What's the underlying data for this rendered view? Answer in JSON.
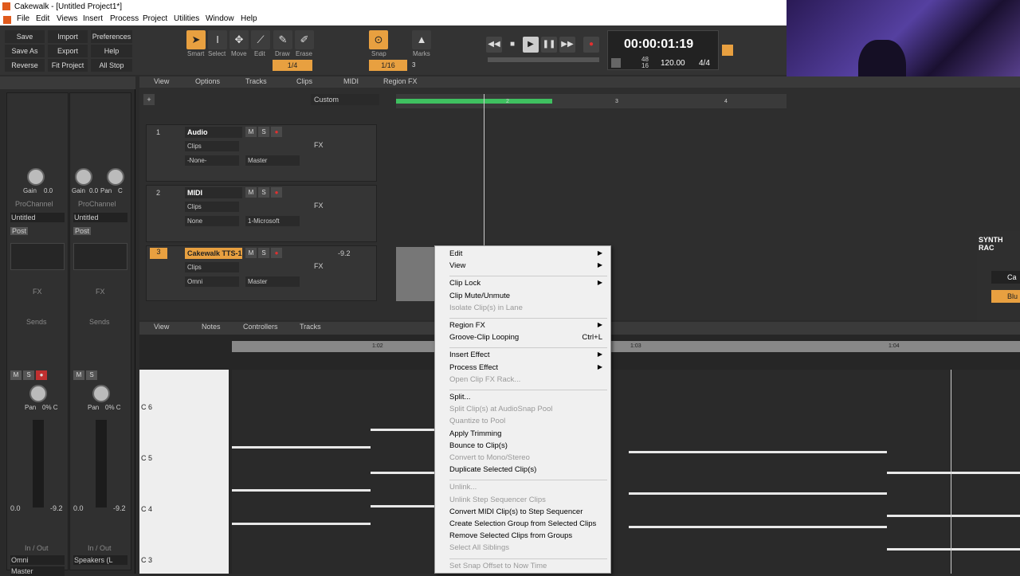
{
  "window": {
    "title": "Cakewalk - [Untitled Project1*]"
  },
  "menubar": [
    "File",
    "Edit",
    "Views",
    "Insert",
    "Process",
    "Project",
    "Utilities",
    "Window",
    "Help"
  ],
  "control_bar": {
    "buttons": [
      "Save",
      "Import",
      "Preferences",
      "Save As",
      "Export",
      "Help",
      "Reverse",
      "Fit Project",
      "All Stop"
    ],
    "tools": [
      "Smart",
      "Select",
      "Move",
      "Edit",
      "Draw",
      "Erase"
    ],
    "tool_value": "1/4",
    "snap_label": "Snap",
    "snap_value": "1/16",
    "snap_extra": "3",
    "marks_label": "Marks"
  },
  "transport": {
    "time": "00:00:01:19",
    "sig_top": "48",
    "sig_bottom": "16",
    "tempo": "120.00",
    "meter": "4/4"
  },
  "inspector": {
    "strips": [
      {
        "gain": "Gain",
        "gain_val": "0.0",
        "prochannel": "ProChannel",
        "name": "Untitled",
        "post": "Post",
        "fx": "FX",
        "sends": "Sends",
        "pan": "Pan",
        "pan_val": "0% C",
        "vol": "0.0",
        "peak": "-9.2",
        "inout": "In / Out",
        "in": "Omni",
        "out": "Master"
      },
      {
        "gain": "Gain",
        "gain_val": "0.0",
        "pan_small": "Pan",
        "pan_small_val": "C",
        "prochannel": "ProChannel",
        "name": "Untitled",
        "post": "Post",
        "fx": "FX",
        "sends": "Sends",
        "pan": "Pan",
        "pan_val": "0% C",
        "vol": "0.0",
        "peak": "-9.2",
        "inout": "In / Out",
        "in": "Speakers (L"
      }
    ]
  },
  "trackview": {
    "menu": [
      "View",
      "Options",
      "Tracks",
      "Clips",
      "MIDI",
      "Region FX"
    ],
    "preset": "Custom",
    "ruler": [
      "2",
      "3",
      "4"
    ],
    "tracks": [
      {
        "num": "1",
        "name": "Audio",
        "clips": "Clips",
        "input": "-None-",
        "output": "Master",
        "fx": "FX"
      },
      {
        "num": "2",
        "name": "MIDI",
        "clips": "Clips",
        "input": "None",
        "output": "1-Microsoft",
        "fx": "FX"
      },
      {
        "num": "3",
        "name": "Cakewalk TTS-1",
        "clips": "Clips",
        "input": "Omni",
        "output": "Master",
        "fx": "FX",
        "level": "-9.2"
      }
    ]
  },
  "synth_rack": {
    "title": "SYNTH RAC",
    "item1": "Ca",
    "item2": "Blu"
  },
  "pianoroll": {
    "menu": [
      "View",
      "Notes",
      "Controllers",
      "Tracks"
    ],
    "ruler": [
      "1:02",
      "1:03",
      "1:04"
    ],
    "keys": [
      "C 6",
      "C 5",
      "C 4",
      "C 3"
    ]
  },
  "context_menu": {
    "items": [
      {
        "label": "Edit",
        "sub": true,
        "dis": false
      },
      {
        "label": "View",
        "sub": true,
        "dis": false
      },
      {
        "sep": true
      },
      {
        "label": "Clip Lock",
        "sub": true,
        "dis": false
      },
      {
        "label": "Clip Mute/Unmute",
        "dis": false
      },
      {
        "label": "Isolate Clip(s) in Lane",
        "dis": true
      },
      {
        "sep": true
      },
      {
        "label": "Region FX",
        "sub": true,
        "dis": false
      },
      {
        "label": "Groove-Clip Looping",
        "dis": false,
        "shortcut": "Ctrl+L"
      },
      {
        "sep": true
      },
      {
        "label": "Insert Effect",
        "sub": true,
        "dis": false
      },
      {
        "label": "Process Effect",
        "sub": true,
        "dis": false
      },
      {
        "label": "Open Clip FX Rack...",
        "dis": true
      },
      {
        "sep": true
      },
      {
        "label": "Split...",
        "dis": false
      },
      {
        "label": "Split Clip(s) at AudioSnap Pool",
        "dis": true
      },
      {
        "label": "Quantize to Pool",
        "dis": true
      },
      {
        "label": "Apply Trimming",
        "dis": false
      },
      {
        "label": "Bounce to Clip(s)",
        "dis": false
      },
      {
        "label": "Convert to Mono/Stereo",
        "dis": true
      },
      {
        "label": "Duplicate Selected Clip(s)",
        "dis": false
      },
      {
        "sep": true
      },
      {
        "label": "Unlink...",
        "dis": true
      },
      {
        "label": "Unlink Step Sequencer Clips",
        "dis": true
      },
      {
        "label": "Convert MIDI Clip(s) to Step Sequencer",
        "dis": false
      },
      {
        "label": "Create Selection Group from Selected Clips",
        "dis": false
      },
      {
        "label": "Remove Selected Clips from Groups",
        "dis": false
      },
      {
        "label": "Select All Siblings",
        "dis": true
      },
      {
        "sep": true
      },
      {
        "label": "Set Snap Offset to Now Time",
        "dis": true
      }
    ]
  }
}
